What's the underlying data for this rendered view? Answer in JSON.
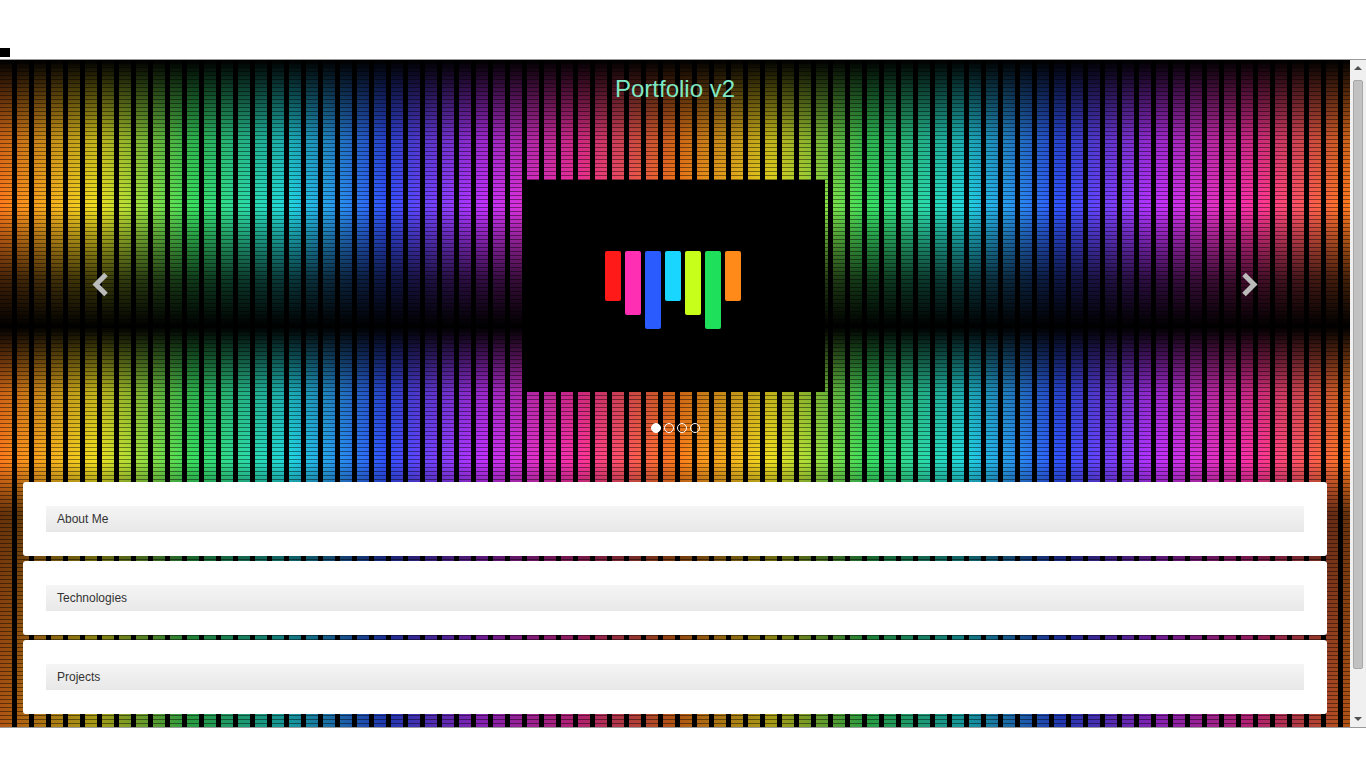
{
  "page": {
    "title": "Portfolio v2"
  },
  "carousel": {
    "indicators": [
      {
        "selected": true
      },
      {
        "selected": false
      },
      {
        "selected": false
      },
      {
        "selected": false
      }
    ]
  },
  "panels": [
    {
      "label": "About Me"
    },
    {
      "label": "Technologies"
    },
    {
      "label": "Projects"
    }
  ]
}
